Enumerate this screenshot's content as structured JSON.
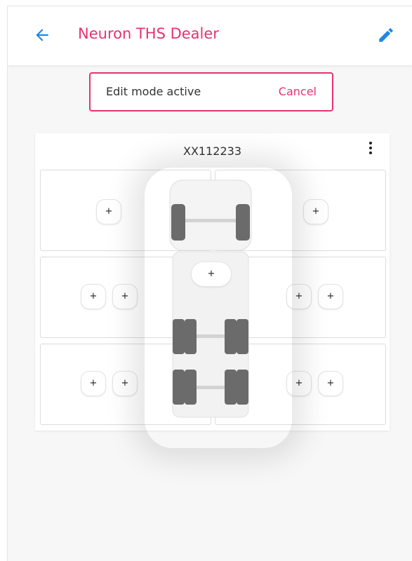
{
  "appbar": {
    "title": "Neuron THS Dealer",
    "back_icon": "arrow-left-icon",
    "edit_icon": "pencil-icon"
  },
  "edit_banner": {
    "message": "Edit mode active",
    "cancel_label": "Cancel"
  },
  "vehicle": {
    "plate": "XX112233",
    "menu_icon": "more-vertical-icon",
    "add_label": "+",
    "slots": {
      "front_left": [
        "+"
      ],
      "front_right": [
        "+"
      ],
      "middle_left": [
        "+",
        "+"
      ],
      "middle_right": [
        "+",
        "+"
      ],
      "rear_left": [
        "+",
        "+"
      ],
      "rear_right": [
        "+",
        "+"
      ],
      "spare": "+"
    }
  },
  "colors": {
    "accent": "#e6336f",
    "back_arrow": "#1e88e5",
    "edit_pencil": "#1e88e5",
    "tire": "#6b6b6b"
  }
}
